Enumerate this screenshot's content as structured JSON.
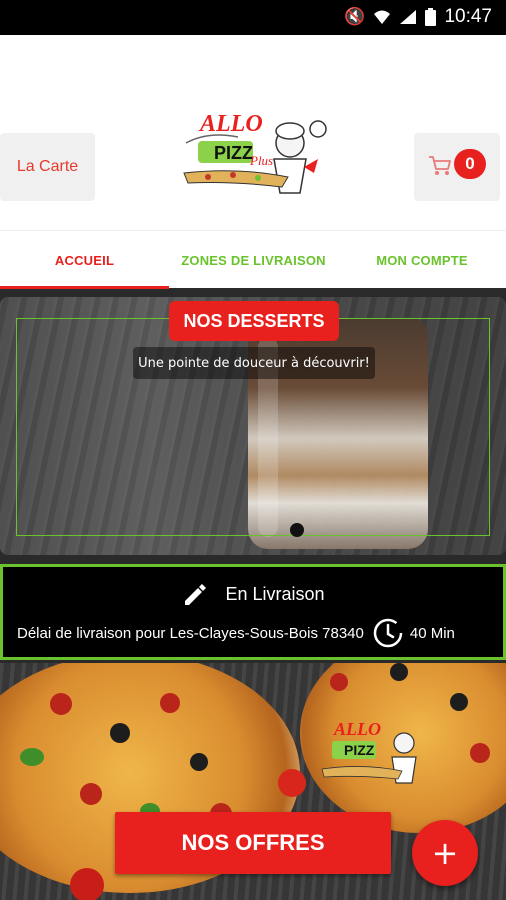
{
  "status_bar": {
    "time": "10:47",
    "icons": [
      "mute-icon",
      "wifi-icon",
      "signal-icon",
      "battery-icon"
    ]
  },
  "header": {
    "menu_button_label": "La Carte",
    "cart_count": "0",
    "logo_text": "ALLO PIZZA"
  },
  "tabs": [
    {
      "label": "ACCUEIL",
      "active": true
    },
    {
      "label": "ZONES DE LIVRAISON",
      "active": false
    },
    {
      "label": "MON COMPTE",
      "active": false
    }
  ],
  "banner": {
    "title": "NOS DESSERTS",
    "subtitle": "Une pointe de douceur à découvrir!"
  },
  "delivery": {
    "mode_label": "En Livraison",
    "delay_text": "Délai de livraison pour Les-Clayes-Sous-Bois 78340",
    "delay_value": "40 Min"
  },
  "promo": {
    "offers_button_label": "NOS OFFRES",
    "fab_label": "+"
  },
  "colors": {
    "accent_red": "#e8201e",
    "accent_green": "#6ac32c"
  }
}
